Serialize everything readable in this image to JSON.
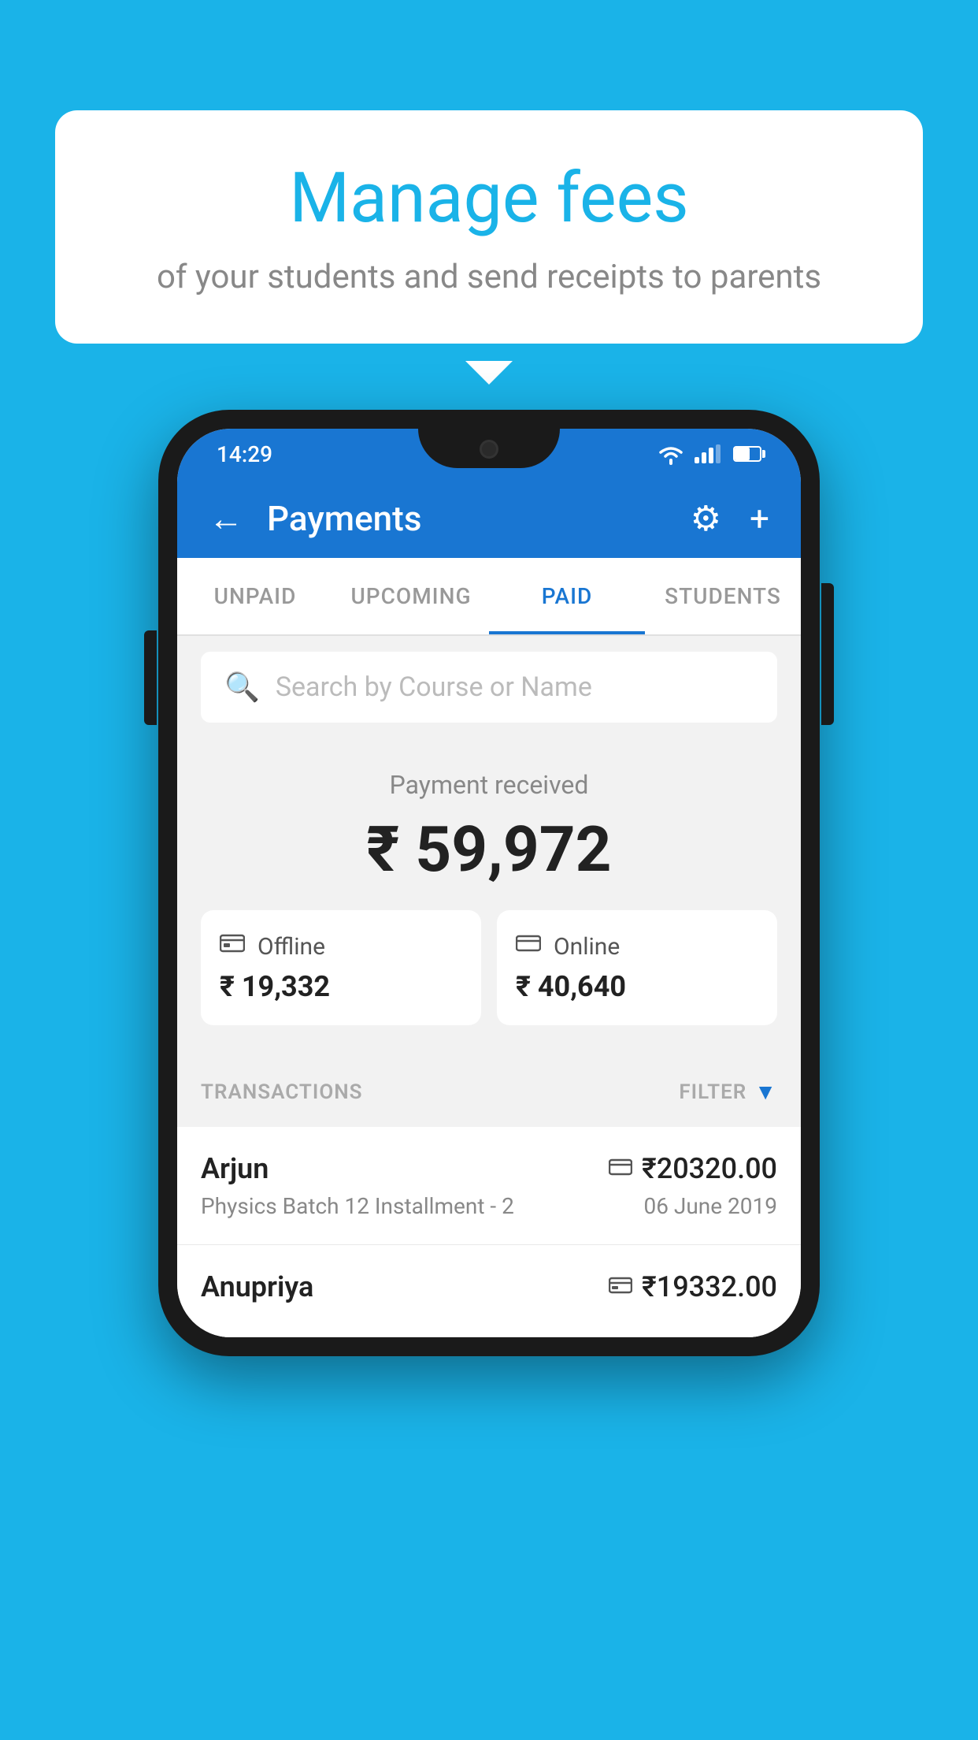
{
  "background_color": "#1ab3e8",
  "bubble": {
    "title": "Manage fees",
    "subtitle": "of your students and send receipts to parents"
  },
  "status_bar": {
    "time": "14:29",
    "color": "#1976d2"
  },
  "app_bar": {
    "title": "Payments",
    "back_label": "←",
    "gear_label": "⚙",
    "plus_label": "+"
  },
  "tabs": [
    {
      "label": "UNPAID",
      "active": false
    },
    {
      "label": "UPCOMING",
      "active": false
    },
    {
      "label": "PAID",
      "active": true
    },
    {
      "label": "STUDENTS",
      "active": false
    }
  ],
  "search": {
    "placeholder": "Search by Course or Name"
  },
  "payment_received": {
    "label": "Payment received",
    "amount": "₹ 59,972",
    "offline": {
      "type": "Offline",
      "amount": "₹ 19,332"
    },
    "online": {
      "type": "Online",
      "amount": "₹ 40,640"
    }
  },
  "transactions": {
    "label": "TRANSACTIONS",
    "filter_label": "FILTER",
    "items": [
      {
        "name": "Arjun",
        "course": "Physics Batch 12 Installment - 2",
        "amount": "₹20320.00",
        "date": "06 June 2019",
        "method": "online"
      },
      {
        "name": "Anupriya",
        "course": "",
        "amount": "₹19332.00",
        "date": "",
        "method": "offline"
      }
    ]
  }
}
